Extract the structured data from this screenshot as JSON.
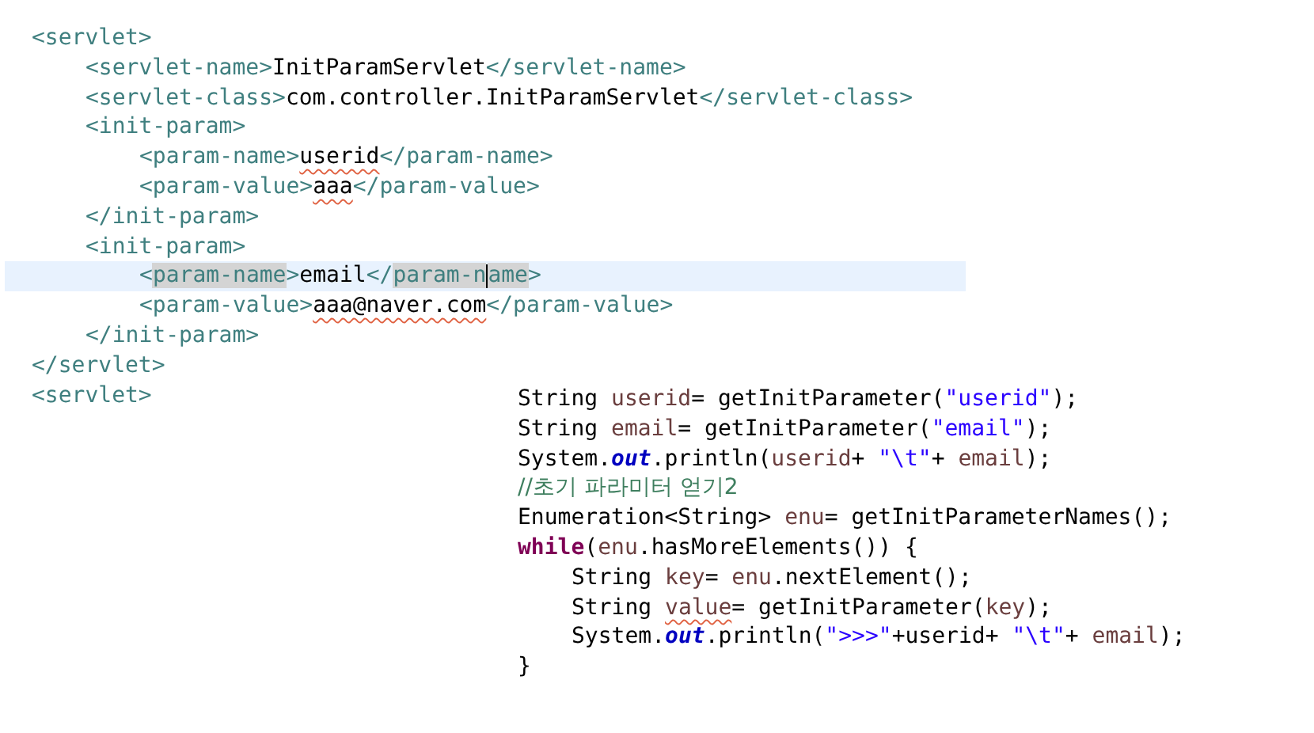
{
  "xml_lines": [
    {
      "tokens": [
        {
          "text": "<servlet>",
          "kind": "tag"
        }
      ],
      "children": [
        {
          "tokens": [
            {
              "text": "<servlet-name>",
              "kind": "tag"
            },
            {
              "text": "InitParamServlet",
              "kind": "plain"
            },
            {
              "text": "</servlet-name>",
              "kind": "tag"
            }
          ]
        },
        {
          "tokens": [
            {
              "text": "<servlet-class>",
              "kind": "tag"
            },
            {
              "text": "com.controller.InitParamServlet",
              "kind": "plain"
            },
            {
              "text": "</servlet-class>",
              "kind": "tag"
            }
          ]
        },
        {
          "tokens": [
            {
              "text": "<init-param>",
              "kind": "tag"
            }
          ],
          "children": [
            {
              "tokens": [
                {
                  "text": "<param-name>",
                  "kind": "tag"
                },
                {
                  "text": "userid",
                  "kind": "plain",
                  "squiggle": true
                },
                {
                  "text": "</param-name>",
                  "kind": "tag"
                }
              ]
            },
            {
              "tokens": [
                {
                  "text": "<param-value>",
                  "kind": "tag"
                },
                {
                  "text": "aaa",
                  "kind": "plain",
                  "squiggle": true
                },
                {
                  "text": "</param-value>",
                  "kind": "tag"
                }
              ]
            }
          ]
        },
        {
          "tokens": [
            {
              "text": "</init-param>",
              "kind": "tag"
            }
          ]
        },
        {
          "tokens": [
            {
              "text": "<init-param>",
              "kind": "tag"
            }
          ],
          "children": [
            {
              "selected": true,
              "tokens": [
                {
                  "text": "<",
                  "kind": "tag"
                },
                {
                  "text": "param-name",
                  "kind": "tag",
                  "marked": true
                },
                {
                  "text": ">",
                  "kind": "tag"
                },
                {
                  "text": "email",
                  "kind": "plain"
                },
                {
                  "text": "</",
                  "kind": "tag"
                },
                {
                  "text": "param-n",
                  "kind": "tag",
                  "marked": true
                },
                {
                  "kind": "caret"
                },
                {
                  "text": "ame",
                  "kind": "tag",
                  "marked": true
                },
                {
                  "text": ">",
                  "kind": "tag"
                }
              ]
            },
            {
              "tokens": [
                {
                  "text": "<param-value>",
                  "kind": "tag"
                },
                {
                  "text": "aaa@naver.com",
                  "kind": "plain",
                  "squiggle": true
                },
                {
                  "text": "</param-value>",
                  "kind": "tag"
                }
              ]
            }
          ]
        },
        {
          "tokens": [
            {
              "text": "</init-param>",
              "kind": "tag"
            }
          ]
        }
      ]
    },
    {
      "tokens": [
        {
          "text": "</servlet>",
          "kind": "tag"
        }
      ]
    },
    {
      "tokens": [
        {
          "text": "<servlet>",
          "kind": "tag"
        }
      ]
    }
  ],
  "java_lines": [
    {
      "tokens": [
        {
          "text": "String ",
          "kind": "plain"
        },
        {
          "text": "userid",
          "kind": "var"
        },
        {
          "text": "= getInitParameter(",
          "kind": "plain"
        },
        {
          "text": "\"userid\"",
          "kind": "string"
        },
        {
          "text": ");",
          "kind": "plain"
        }
      ]
    },
    {
      "tokens": [
        {
          "text": "String ",
          "kind": "plain"
        },
        {
          "text": "email",
          "kind": "var"
        },
        {
          "text": "= getInitParameter(",
          "kind": "plain"
        },
        {
          "text": "\"email\"",
          "kind": "string"
        },
        {
          "text": ");",
          "kind": "plain"
        }
      ]
    },
    {
      "tokens": [
        {
          "text": "System.",
          "kind": "plain"
        },
        {
          "text": "out",
          "kind": "field"
        },
        {
          "text": ".println(",
          "kind": "plain"
        },
        {
          "text": "userid",
          "kind": "var"
        },
        {
          "text": "+ ",
          "kind": "plain"
        },
        {
          "text": "\"\\t\"",
          "kind": "string"
        },
        {
          "text": "+ ",
          "kind": "plain"
        },
        {
          "text": "email",
          "kind": "var"
        },
        {
          "text": ");",
          "kind": "plain"
        }
      ]
    },
    {
      "tokens": [
        {
          "text": "//초기 파라미터 얻기2",
          "kind": "comment"
        }
      ]
    },
    {
      "tokens": [
        {
          "text": "Enumeration<String> ",
          "kind": "plain"
        },
        {
          "text": "enu",
          "kind": "var"
        },
        {
          "text": "= getInitParameterNames();",
          "kind": "plain"
        }
      ]
    },
    {
      "tokens": [
        {
          "text": "while",
          "kind": "keyword"
        },
        {
          "text": "(",
          "kind": "plain"
        },
        {
          "text": "enu",
          "kind": "var"
        },
        {
          "text": ".hasMoreElements()) {",
          "kind": "plain"
        }
      ],
      "children": [
        {
          "tokens": [
            {
              "text": "String ",
              "kind": "plain"
            },
            {
              "text": "key",
              "kind": "var"
            },
            {
              "text": "= ",
              "kind": "plain"
            },
            {
              "text": "enu",
              "kind": "var"
            },
            {
              "text": ".nextElement();",
              "kind": "plain"
            }
          ]
        },
        {
          "tokens": [
            {
              "text": "String ",
              "kind": "plain"
            },
            {
              "text": "value",
              "kind": "var",
              "squiggle": true
            },
            {
              "text": "= getInitParameter(",
              "kind": "plain"
            },
            {
              "text": "key",
              "kind": "var"
            },
            {
              "text": ");",
              "kind": "plain"
            }
          ]
        },
        {
          "tokens": [
            {
              "text": "System.",
              "kind": "plain"
            },
            {
              "text": "out",
              "kind": "field"
            },
            {
              "text": ".println(",
              "kind": "plain"
            },
            {
              "text": "\">>>\"",
              "kind": "string"
            },
            {
              "text": "+userid+ ",
              "kind": "plain"
            },
            {
              "text": "\"\\t\"",
              "kind": "string"
            },
            {
              "text": "+ ",
              "kind": "plain"
            },
            {
              "text": "email",
              "kind": "var"
            },
            {
              "text": ");",
              "kind": "plain"
            }
          ]
        }
      ]
    },
    {
      "tokens": [
        {
          "text": "}",
          "kind": "plain"
        }
      ]
    }
  ]
}
